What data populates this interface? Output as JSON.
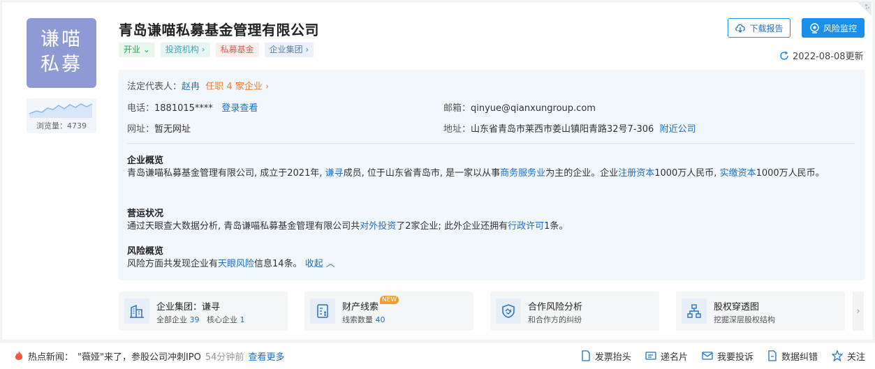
{
  "company": {
    "logo_line1": "谦喵",
    "logo_line2": "私募",
    "name": "青岛谦喵私募基金管理有限公司",
    "views_label": "浏览量：",
    "views_count": "4739",
    "tags": {
      "status": "开业",
      "investor": "投资机构",
      "fund": "私募基金",
      "group": "企业集团"
    }
  },
  "buttons": {
    "download": "下载报告",
    "monitor": "风险监控"
  },
  "updated": "2022-08-08更新",
  "info": {
    "legal_rep_label": "法定代表人：",
    "legal_rep_name": "赵冉",
    "legal_rep_posts": "任职 4 家企业",
    "phone_label": "电话：",
    "phone_value": "1881015****",
    "phone_link": "登录查看",
    "email_label": "邮箱：",
    "email_value": "qinyue@qianxungroup.com",
    "website_label": "网址：",
    "website_value": "暂无网址",
    "address_label": "地址：",
    "address_value": "山东省青岛市莱西市姜山镇阳青路32号7-306",
    "address_link": "附近公司"
  },
  "overview": {
    "heading": "企业概览",
    "p1": "青岛谦喵私募基金管理有限公司, 成立于2021年, ",
    "l1": "谦寻",
    "p2": "成员, 位于山东省青岛市, 是一家以从事",
    "l2": "商务服务业",
    "p3": "为主的企业。企业",
    "l3": "注册资本",
    "p4": "1000万人民币, ",
    "l4": "实缴资本",
    "p5": "1000万人民币。"
  },
  "operation": {
    "heading": "营运状况",
    "p1": "通过天眼查大数据分析, 青岛谦喵私募基金管理有限公司共",
    "l1": "对外投资",
    "p2": "了2家企业; 此外企业还拥有",
    "l2": "行政许可",
    "p3": "1条。"
  },
  "risk": {
    "heading": "风险概览",
    "p1": "风险方面共发现企业有",
    "l1": "天眼风险",
    "p2": "信息14条。",
    "collapse": "收起"
  },
  "tiles": [
    {
      "title": "企业集团：谦寻",
      "sub_a": "全部企业",
      "sub_a_val": "39",
      "sub_b": "核心企业",
      "sub_b_val": "1"
    },
    {
      "title": "财产线索",
      "badge": "NEW",
      "sub_a": "线索数量",
      "sub_a_val": "40"
    },
    {
      "title": "合作风险分析",
      "sub": "和合作方的纠纷"
    },
    {
      "title": "股权穿透图",
      "sub": "挖掘深层股权结构"
    }
  ],
  "footer": {
    "news_label": "热点新闻：",
    "news_text": "\"薇娅\"来了，参股公司冲刺IPO",
    "news_time": "54分钟前",
    "news_more": "查看更多",
    "actions": [
      "发票抬头",
      "递名片",
      "我要投诉",
      "数据纠错",
      "关注"
    ]
  },
  "colors": {
    "brand_blue": "#1d8ee8",
    "link_blue": "#1d6fc4",
    "logo_bg": "#8d9ad3",
    "orange": "#f07b2c"
  }
}
